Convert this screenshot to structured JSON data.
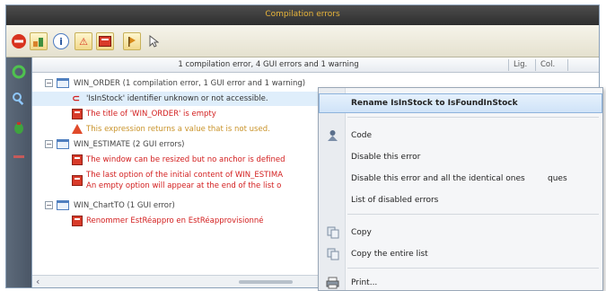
{
  "window": {
    "title": "Compilation errors"
  },
  "toolbar": {
    "buttons": [
      "stop-icon",
      "build-icon",
      "info-icon",
      "warning-icon",
      "error-icon",
      "flag-icon",
      "cursor-icon"
    ],
    "info_glyph": "i",
    "warning_glyph": "⚠"
  },
  "header": {
    "summary": "1 compilation error, 4 GUI errors and 1 warning",
    "col_line": "Lig.",
    "col_col": "Col."
  },
  "tree": {
    "win_order": {
      "label": "WIN_ORDER (1 compilation error, 1 GUI error and 1 warning)",
      "items": [
        "'IsInStock' identifier unknown or not accessible.",
        "The title of 'WIN_ORDER' is empty",
        "This expression returns a value that is not used."
      ]
    },
    "win_estimate": {
      "label": "WIN_ESTIMATE (2 GUI errors)",
      "items": [
        "The window can be resized but no anchor is defined",
        "The last option of the initial content of WIN_ESTIMA",
        "An empty option will appear at the end of the list o"
      ]
    },
    "win_chartto": {
      "label": "WIN_ChartTO (1 GUI error)",
      "items": [
        "Renommer EstRéappro en EstRéapprovisionné"
      ]
    }
  },
  "context_menu": {
    "rename": "Rename IsInStock to IsFoundInStock",
    "code": "Code",
    "disable_error": "Disable this error",
    "disable_identical": "Disable this error and all the identical ones",
    "disable_identical_suffix": "ques",
    "list_disabled": "List of disabled errors",
    "copy": "Copy",
    "copy_list": "Copy the entire list",
    "print": "Print..."
  },
  "colors": {
    "title_text": "#e8b43a",
    "error_text": "#d32020",
    "warning_text": "#c9932a",
    "highlight": "#cfe3f8"
  }
}
